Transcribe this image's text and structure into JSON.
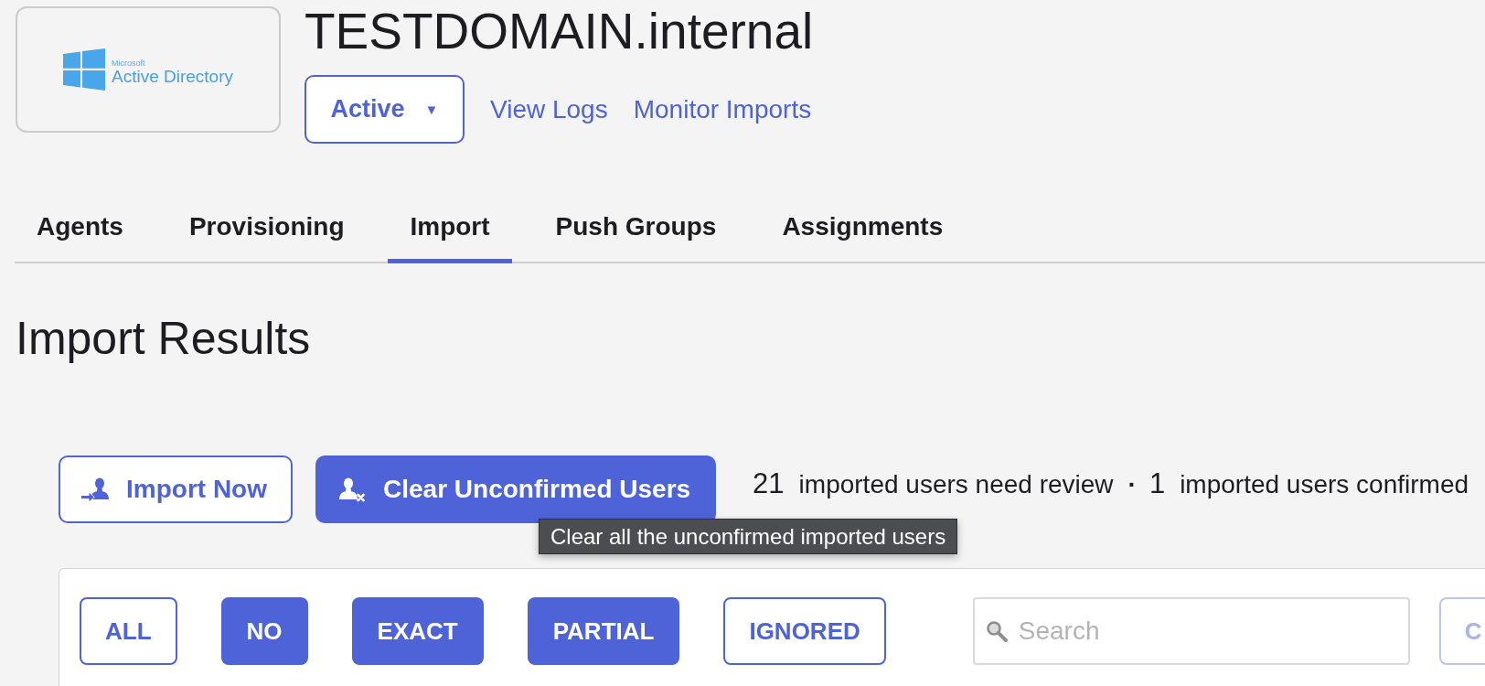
{
  "logo": {
    "brand": "Microsoft",
    "product": "Active Directory"
  },
  "header": {
    "title": "TESTDOMAIN.internal",
    "status_dropdown": {
      "label": "Active",
      "caret": "▼"
    },
    "links": [
      "View Logs",
      "Monitor Imports"
    ]
  },
  "tabs": [
    {
      "label": "Agents",
      "selected": false
    },
    {
      "label": "Provisioning",
      "selected": false
    },
    {
      "label": "Import",
      "selected": true
    },
    {
      "label": "Push Groups",
      "selected": false
    },
    {
      "label": "Assignments",
      "selected": false
    }
  ],
  "section_title": "Import Results",
  "actions": [
    {
      "kind": "import",
      "label": "Import Now"
    },
    {
      "kind": "clear",
      "label": "Clear Unconfirmed Users"
    }
  ],
  "summary": {
    "items": [
      {
        "count": "21",
        "text": "imported users need review"
      },
      {
        "count": "1",
        "text": "imported users confirmed"
      }
    ],
    "separator": "·"
  },
  "tooltip": "Clear all the unconfirmed imported users",
  "filters": [
    {
      "label": "ALL",
      "selected": false
    },
    {
      "label": "NO",
      "selected": true
    },
    {
      "label": "EXACT",
      "selected": true
    },
    {
      "label": "PARTIAL",
      "selected": true
    },
    {
      "label": "IGNORED",
      "selected": false
    }
  ],
  "search": {
    "placeholder": "Search"
  },
  "cut_off_button": {
    "label": "C",
    "disabled": true
  }
}
